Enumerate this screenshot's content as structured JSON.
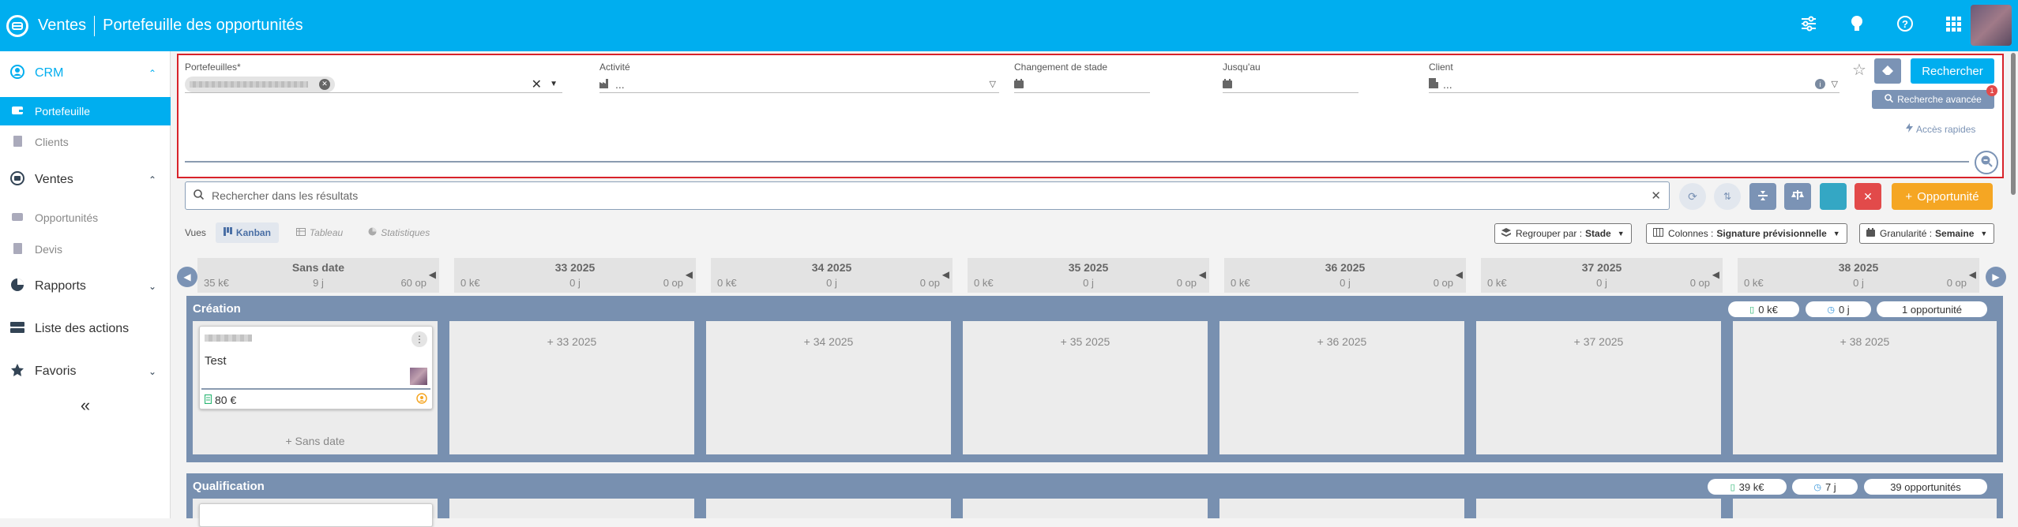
{
  "header": {
    "app_name": "Ventes",
    "page_title": "Portefeuille des opportunités",
    "icons": [
      "sliders-icon",
      "lightbulb-icon",
      "help-icon",
      "apps-grid-icon"
    ]
  },
  "sidebar": {
    "crm": "CRM",
    "portefeuille": "Portefeuille",
    "clients": "Clients",
    "ventes": "Ventes",
    "opportunites": "Opportunités",
    "devis": "Devis",
    "rapports": "Rapports",
    "actions": "Liste des actions",
    "favoris": "Favoris",
    "collapse": "«"
  },
  "filters": {
    "portefeuilles_label": "Portefeuilles*",
    "activite_label": "Activité",
    "activite_value": "...",
    "changement_label": "Changement de stade",
    "jusquau_label": "Jusqu'au",
    "client_label": "Client",
    "client_value": "...",
    "search_btn": "Rechercher",
    "advanced_btn": "Recherche avancée",
    "advanced_badge": "1",
    "quick_access": "Accès rapides"
  },
  "results": {
    "placeholder": "Rechercher dans les résultats",
    "new_btn": "Opportunité"
  },
  "views": {
    "label": "Vues",
    "kanban": "Kanban",
    "tableau": "Tableau",
    "stats": "Statistiques"
  },
  "options": {
    "group_label": "Regrouper par :",
    "group_value": "Stade",
    "cols_label": "Colonnes :",
    "cols_value": "Signature prévisionnelle",
    "gran_label": "Granularité :",
    "gran_value": "Semaine"
  },
  "columns": [
    {
      "title": "Sans date",
      "amount": "35 k€",
      "days": "9 j",
      "count": "60 op"
    },
    {
      "title": "33 2025",
      "amount": "0 k€",
      "days": "0 j",
      "count": "0 op"
    },
    {
      "title": "34 2025",
      "amount": "0 k€",
      "days": "0 j",
      "count": "0 op"
    },
    {
      "title": "35 2025",
      "amount": "0 k€",
      "days": "0 j",
      "count": "0 op"
    },
    {
      "title": "36 2025",
      "amount": "0 k€",
      "days": "0 j",
      "count": "0 op"
    },
    {
      "title": "37 2025",
      "amount": "0 k€",
      "days": "0 j",
      "count": "0 op"
    },
    {
      "title": "38 2025",
      "amount": "0 k€",
      "days": "0 j",
      "count": "0 op"
    }
  ],
  "stages": [
    {
      "name": "Création",
      "amount": "0 k€",
      "days": "0 j",
      "count": "1 opportunité",
      "cells": [
        "+ Sans date",
        "+ 33 2025",
        "+ 34 2025",
        "+ 35 2025",
        "+ 36 2025",
        "+ 37 2025",
        "+ 38 2025"
      ],
      "card": {
        "title": "Test",
        "amount": "80 €"
      }
    },
    {
      "name": "Qualification",
      "amount": "39 k€",
      "days": "7 j",
      "count": "39 opportunités"
    }
  ],
  "colors": {
    "primary": "#00aeef",
    "stage": "#7890b0",
    "orange": "#f5a623",
    "red": "#e24a4a",
    "teal": "#34a7c4"
  }
}
